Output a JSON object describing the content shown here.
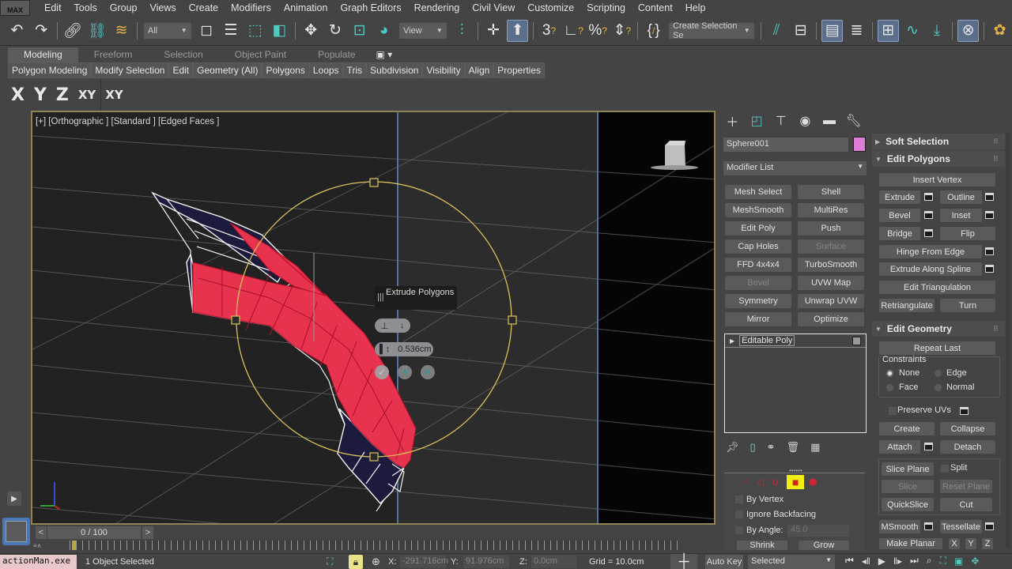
{
  "app": {
    "logo": "MAX"
  },
  "menu": [
    "Edit",
    "Tools",
    "Group",
    "Views",
    "Create",
    "Modifiers",
    "Animation",
    "Graph Editors",
    "Rendering",
    "Civil View",
    "Customize",
    "Scripting",
    "Content",
    "Help"
  ],
  "toolbar": {
    "selection_filter": "All",
    "reference_coord": "View",
    "named_selection": "Create Selection Se",
    "icons": [
      "undo-icon",
      "redo-icon",
      "link-icon",
      "unlink-icon",
      "bind-space-warp-icon",
      "select-object-icon",
      "select-by-name-icon",
      "rectangular-selection-icon",
      "window-crossing-icon",
      "move-icon",
      "rotate-icon",
      "scale-icon",
      "placement-icon",
      "pivot-center-icon",
      "select-manipulate-icon",
      "keyboard-shortcut-override-icon",
      "snap-3d-icon",
      "angle-snap-icon",
      "percent-snap-icon",
      "spinner-snap-icon",
      "edit-named-selection-icon",
      "mirror-icon",
      "align-icon",
      "scene-explorer-icon",
      "layer-explorer-icon",
      "toggle-ribbon-icon",
      "curve-editor-icon",
      "schematic-view-icon",
      "material-editor-icon",
      "render-setup-icon"
    ]
  },
  "ribbon": {
    "tabs": [
      "Modeling",
      "Freeform",
      "Selection",
      "Object Paint",
      "Populate"
    ],
    "active_tab": "Modeling",
    "panels": [
      "Polygon Modeling",
      "Modify Selection",
      "Edit",
      "Geometry (All)",
      "Polygons",
      "Loops",
      "Tris",
      "Subdivision",
      "Visibility",
      "Align",
      "Properties"
    ]
  },
  "axis_constraints": [
    "X",
    "Y",
    "Z",
    "XY",
    "XY"
  ],
  "viewport": {
    "label": "[+] [Orthographic ] [Standard ] [Edged Faces ]",
    "selected_color": "#e8334f",
    "unselected_color": "#1d1b3d",
    "gizmo_color": "#d9c25a"
  },
  "caddy": {
    "title": "Extrude Polygons",
    "value": "0.536cm",
    "ok": "✓",
    "apply": "+",
    "cancel": "✕"
  },
  "command_panel": {
    "tabs": [
      "create-tab",
      "modify-tab",
      "hierarchy-tab",
      "motion-tab",
      "display-tab",
      "utilities-tab"
    ],
    "active_tab": "modify-tab",
    "object_name": "Sphere001",
    "object_color": "#e17bd8",
    "modifier_list": "Modifier List",
    "modifier_buttons": [
      {
        "label": "Mesh Select",
        "enabled": true
      },
      {
        "label": "Shell",
        "enabled": true
      },
      {
        "label": "MeshSmooth",
        "enabled": true
      },
      {
        "label": "MultiRes",
        "enabled": true
      },
      {
        "label": "Edit Poly",
        "enabled": true
      },
      {
        "label": "Push",
        "enabled": true
      },
      {
        "label": "Cap Holes",
        "enabled": true
      },
      {
        "label": "Surface",
        "enabled": false
      },
      {
        "label": "FFD 4x4x4",
        "enabled": true
      },
      {
        "label": "TurboSmooth",
        "enabled": true
      },
      {
        "label": "Bevel",
        "enabled": false
      },
      {
        "label": "UVW Map",
        "enabled": true
      },
      {
        "label": "Symmetry",
        "enabled": true
      },
      {
        "label": "Unwrap UVW",
        "enabled": true
      },
      {
        "label": "Mirror",
        "enabled": true
      },
      {
        "label": "Optimize",
        "enabled": true
      }
    ],
    "stack": [
      "Editable Poly"
    ],
    "selection": {
      "by_vertex": "By Vertex",
      "ignore_backfacing": "Ignore Backfacing",
      "by_angle": "By Angle:",
      "by_angle_value": "45.0",
      "shrink": "Shrink",
      "grow": "Grow",
      "active_subobject": "polygon"
    },
    "soft_selection": "Soft Selection",
    "edit_polygons": {
      "title": "Edit Polygons",
      "insert_vertex": "Insert Vertex",
      "extrude": "Extrude",
      "outline": "Outline",
      "bevel": "Bevel",
      "inset": "Inset",
      "bridge": "Bridge",
      "flip": "Flip",
      "hinge": "Hinge From Edge",
      "extrude_spline": "Extrude Along Spline",
      "edit_triangulation": "Edit Triangulation",
      "retriangulate": "Retriangulate",
      "turn": "Turn"
    },
    "edit_geometry": {
      "title": "Edit Geometry",
      "repeat_last": "Repeat Last",
      "constraints": "Constraints",
      "none": "None",
      "edge": "Edge",
      "face": "Face",
      "normal": "Normal",
      "constraint_selected": "None",
      "preserve_uvs": "Preserve UVs",
      "create": "Create",
      "collapse": "Collapse",
      "attach": "Attach",
      "detach": "Detach",
      "slice_plane": "Slice Plane",
      "split": "Split",
      "slice": "Slice",
      "reset_plane": "Reset Plane",
      "quickslice": "QuickSlice",
      "cut": "Cut",
      "msmooth": "MSmooth",
      "tessellate": "Tessellate",
      "make_planar": "Make Planar",
      "x": "X",
      "y": "Y",
      "z": "Z"
    }
  },
  "timeline": {
    "frame": "0 / 100",
    "prev": "<",
    "next": ">"
  },
  "status": {
    "maxscript": "actionMan.exe",
    "selection": "1 Object Selected",
    "x_label": "X:",
    "x_value": "-291.716cm",
    "y_label": "Y:",
    "y_value": "91.976cm",
    "z_label": "Z:",
    "z_value": "0.0cm",
    "grid": "Grid = 10.0cm",
    "auto_key": "Auto Key",
    "key_filter": "Selected"
  }
}
